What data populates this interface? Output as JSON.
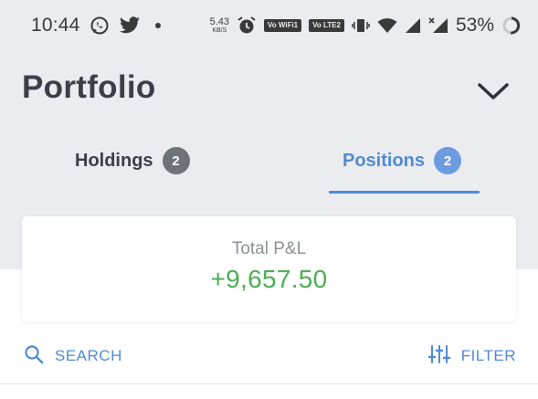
{
  "status_bar": {
    "time": "10:44",
    "net_speed_value": "5.43",
    "net_speed_unit": "KB/S",
    "volte_wifi_label": "Vo WiFi1",
    "volte_lte_label": "Vo LTE2",
    "battery": "53%",
    "icons": [
      "whatsapp-icon",
      "twitter-icon",
      "alarm-icon",
      "vibrate-icon",
      "wifi-icon",
      "signal-icon",
      "signal-x-icon",
      "battery-ring-icon"
    ]
  },
  "header": {
    "title": "Portfolio"
  },
  "tabs": [
    {
      "label": "Holdings",
      "count": "2",
      "active": false
    },
    {
      "label": "Positions",
      "count": "2",
      "active": true
    }
  ],
  "pnl": {
    "label": "Total P&L",
    "value": "+9,657.50",
    "value_color": "#4cae54"
  },
  "actions": {
    "search_label": "SEARCH",
    "filter_label": "FILTER"
  },
  "colors": {
    "accent": "#4f8bd4",
    "background_top": "#ebecef",
    "text_dark": "#3b3f4a"
  }
}
